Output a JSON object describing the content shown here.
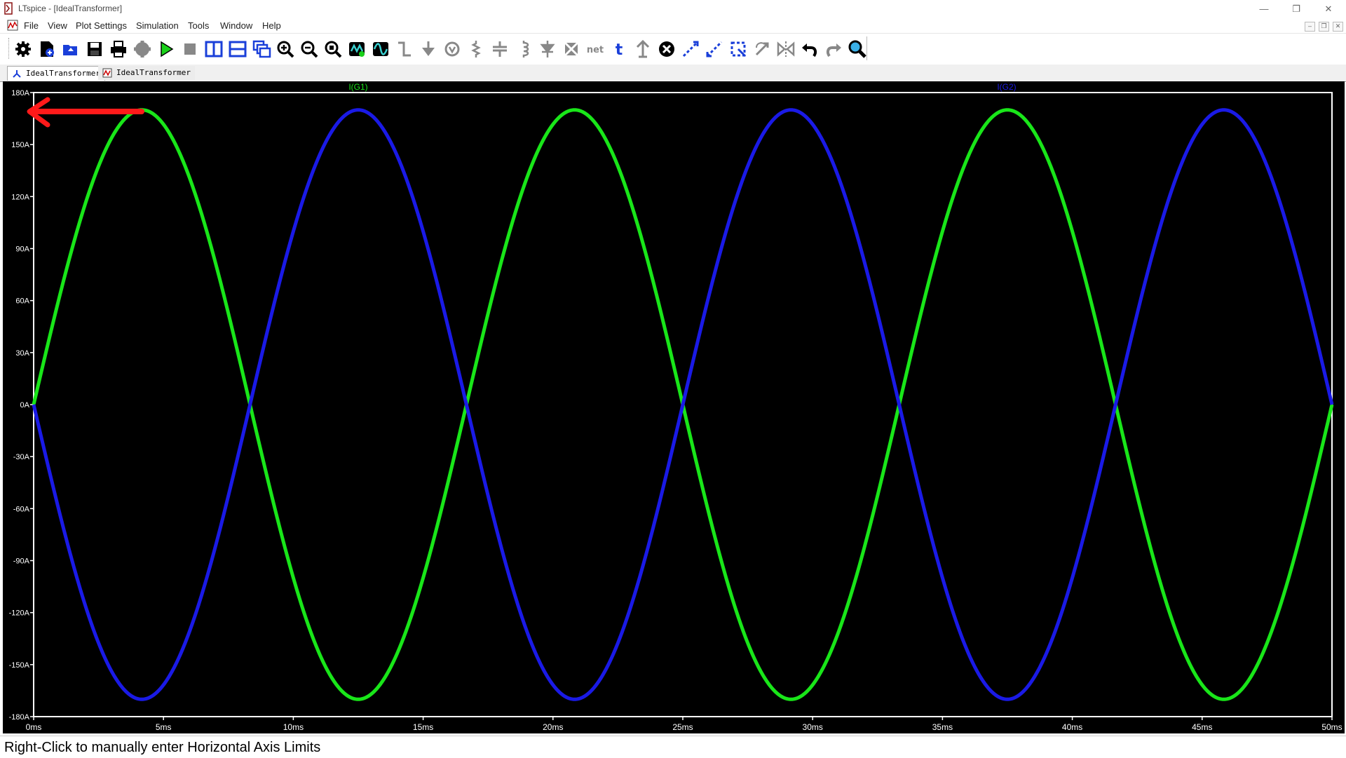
{
  "window": {
    "title": "LTspice - [IdealTransformer]"
  },
  "menu": {
    "items": [
      "File",
      "View",
      "Plot Settings",
      "Simulation",
      "Tools",
      "Window",
      "Help"
    ]
  },
  "toolbar": {
    "buttons": [
      {
        "name": "control-panel-icon"
      },
      {
        "name": "new-schematic-icon"
      },
      {
        "name": "open-file-icon"
      },
      {
        "name": "save-icon"
      },
      {
        "name": "print-icon"
      },
      {
        "name": "halt-icon"
      },
      {
        "name": "run-icon"
      },
      {
        "name": "stop-icon"
      },
      {
        "name": "tile-vertical-icon"
      },
      {
        "name": "tile-horizontal-icon"
      },
      {
        "name": "cascade-icon"
      },
      {
        "name": "zoom-in-icon"
      },
      {
        "name": "zoom-out-icon"
      },
      {
        "name": "zoom-fit-icon"
      },
      {
        "name": "autorange-icon"
      },
      {
        "name": "waveform-icon"
      },
      {
        "name": "wire-icon"
      },
      {
        "name": "ground-icon"
      },
      {
        "name": "voltage-source-icon"
      },
      {
        "name": "resistor-icon"
      },
      {
        "name": "capacitor-icon"
      },
      {
        "name": "inductor-icon"
      },
      {
        "name": "diode-icon"
      },
      {
        "name": "component-icon"
      },
      {
        "name": "net-label-icon"
      },
      {
        "name": "text-icon"
      },
      {
        "name": "spice-directive-icon"
      },
      {
        "name": "delete-icon"
      },
      {
        "name": "duplicate-icon"
      },
      {
        "name": "move-icon"
      },
      {
        "name": "drag-icon"
      },
      {
        "name": "rotate-icon"
      },
      {
        "name": "mirror-icon"
      },
      {
        "name": "undo-icon"
      },
      {
        "name": "redo-icon"
      },
      {
        "name": "find-icon"
      }
    ],
    "net_label": "net",
    "text_label": "t"
  },
  "tabs": [
    {
      "label": "IdealTransformer",
      "icon": "schematic-icon"
    },
    {
      "label": "IdealTransformer",
      "icon": "waveform-tab-icon"
    }
  ],
  "status": {
    "text": "Right-Click to manually enter Horizontal Axis Limits"
  },
  "colors": {
    "plot_bg": "#000000",
    "axis": "#ffffff",
    "trace_g1": "#19e619",
    "trace_g2": "#1a1ae6",
    "annotation_arrow": "#ff1a1a"
  },
  "chart_data": {
    "type": "line",
    "title": "",
    "xlabel": "",
    "ylabel": "",
    "xlim": [
      0,
      50
    ],
    "ylim": [
      -180,
      180
    ],
    "x_ticks": [
      0,
      5,
      10,
      15,
      20,
      25,
      30,
      35,
      40,
      45,
      50
    ],
    "x_tick_labels": [
      "0ms",
      "5ms",
      "10ms",
      "15ms",
      "20ms",
      "25ms",
      "30ms",
      "35ms",
      "40ms",
      "45ms",
      "50ms"
    ],
    "y_ticks": [
      180,
      150,
      120,
      90,
      60,
      30,
      0,
      -30,
      -60,
      -90,
      -120,
      -150,
      -180
    ],
    "y_tick_labels": [
      "180A",
      "150A",
      "120A",
      "90A",
      "60A",
      "30A",
      "0A",
      "-30A",
      "-60A",
      "-90A",
      "-120A",
      "-150A",
      "-180A"
    ],
    "grid": false,
    "series": [
      {
        "name": "I(G1)",
        "amplitude": 170,
        "frequency_hz": 60,
        "phase_deg": 0,
        "x": [
          0,
          4.17,
          8.33,
          12.5,
          16.67,
          20.83,
          25,
          29.17,
          33.33,
          37.5,
          41.67,
          45.83,
          50
        ],
        "y": [
          0,
          170,
          0,
          -170,
          0,
          170,
          0,
          -170,
          0,
          170,
          0,
          -170,
          0
        ]
      },
      {
        "name": "I(G2)",
        "amplitude": 170,
        "frequency_hz": 60,
        "phase_deg": 180,
        "x": [
          0,
          4.17,
          8.33,
          12.5,
          16.67,
          20.83,
          25,
          29.17,
          33.33,
          37.5,
          41.67,
          45.83,
          50
        ],
        "y": [
          0,
          -170,
          0,
          170,
          0,
          -170,
          0,
          170,
          0,
          -170,
          0,
          170,
          0
        ]
      }
    ]
  }
}
